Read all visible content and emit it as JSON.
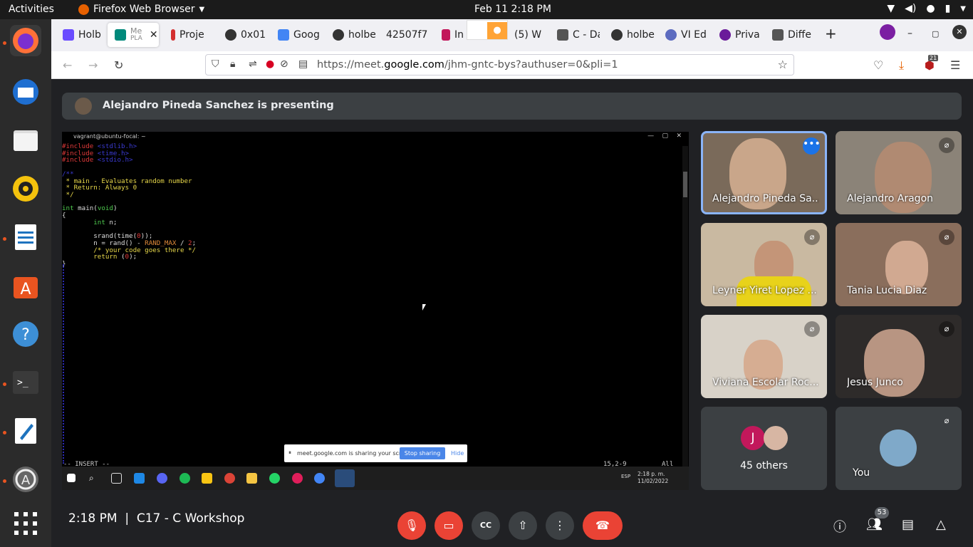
{
  "topbar": {
    "activities": "Activities",
    "app": "Firefox Web Browser",
    "clock": "Feb 11  2:18 PM"
  },
  "tabs": [
    {
      "label": "Holb",
      "color": "#6a4cff"
    },
    {
      "label": "Me​",
      "color": "#00897b",
      "active": true
    },
    {
      "label": "Proje",
      "color": "#d32f2f"
    },
    {
      "label": "0x01",
      "color": "#333333"
    },
    {
      "label": "Goog",
      "color": "#4285f4"
    },
    {
      "label": "holbe",
      "color": "#333333"
    },
    {
      "label": "42507f7",
      "color": "#cccccc"
    },
    {
      "label": "In",
      "color": "#c2185b"
    },
    {
      "label": "(5) W",
      "color": "#ff8f00"
    },
    {
      "label": "C - Da",
      "color": "#555555"
    },
    {
      "label": "holbe",
      "color": "#333333"
    },
    {
      "label": "VI Ed",
      "color": "#5c6bc0"
    },
    {
      "label": "Priva",
      "color": "#6a1b9a"
    },
    {
      "label": "Diffe",
      "color": "#555555"
    }
  ],
  "tab_sub": "PLA",
  "url": {
    "prefix": "https://meet.",
    "domain": "google.com",
    "suffix": "/jhm-gntc-bys?authuser=0&pli=1"
  },
  "ext_badge": "21",
  "banner": "Alejandro Pineda Sanchez is presenting",
  "terminal": {
    "title": "vagrant@ubuntu-focal: ~",
    "statusline_left": "-- INSERT --",
    "statusline_pos": "15,2-9",
    "statusline_all": "All"
  },
  "share": {
    "message": "meet.google.com is sharing your screen.",
    "stop": "Stop sharing",
    "hide": "Hide"
  },
  "taskbar": {
    "lang": "ESP",
    "time": "2:18 p. m.",
    "date": "11/02/2022"
  },
  "participants": [
    {
      "name": "Alejandro Pineda Sa...",
      "speaking": true
    },
    {
      "name": "Alejandro Aragon"
    },
    {
      "name": "Leyner Yiret Lopez ..."
    },
    {
      "name": "Tania Lucia Diaz"
    },
    {
      "name": "Viviana Escolar Roc..."
    },
    {
      "name": "Jesus Junco"
    }
  ],
  "others": {
    "initial": "J",
    "label": "45 others"
  },
  "you": "You",
  "meeting": {
    "time": "2:18 PM",
    "separator": "|",
    "name": "C17 - C Workshop"
  },
  "people_count": "53"
}
